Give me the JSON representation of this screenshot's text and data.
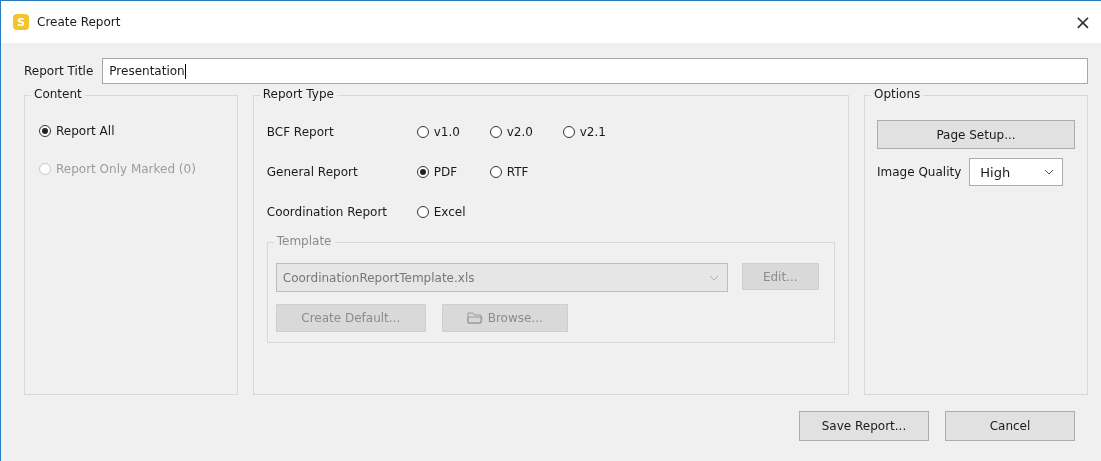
{
  "window": {
    "title": "Create Report",
    "app_icon_letter": "S",
    "close": "×"
  },
  "report_title": {
    "label": "Report Title",
    "value": "Presentation"
  },
  "content": {
    "title": "Content",
    "options": [
      {
        "label": "Report All",
        "selected": true,
        "disabled": false
      },
      {
        "label": "Report Only Marked (0)",
        "selected": false,
        "disabled": true
      }
    ]
  },
  "report_type": {
    "title": "Report Type",
    "rows": [
      {
        "label": "BCF Report",
        "options": [
          {
            "label": "v1.0",
            "selected": false
          },
          {
            "label": "v2.0",
            "selected": false
          },
          {
            "label": "v2.1",
            "selected": false
          }
        ]
      },
      {
        "label": "General Report",
        "options": [
          {
            "label": "PDF",
            "selected": true
          },
          {
            "label": "RTF",
            "selected": false
          }
        ]
      },
      {
        "label": "Coordination Report",
        "options": [
          {
            "label": "Excel",
            "selected": false
          }
        ]
      }
    ],
    "template": {
      "title": "Template",
      "disabled": true,
      "value": "CoordinationReportTemplate.xls",
      "edit_button": "Edit...",
      "create_default_button": "Create Default...",
      "browse_button": "Browse..."
    }
  },
  "options": {
    "title": "Options",
    "page_setup_button": "Page Setup...",
    "image_quality": {
      "label": "Image Quality",
      "value": "High"
    }
  },
  "buttons": [
    "Save Report...",
    "Cancel"
  ]
}
